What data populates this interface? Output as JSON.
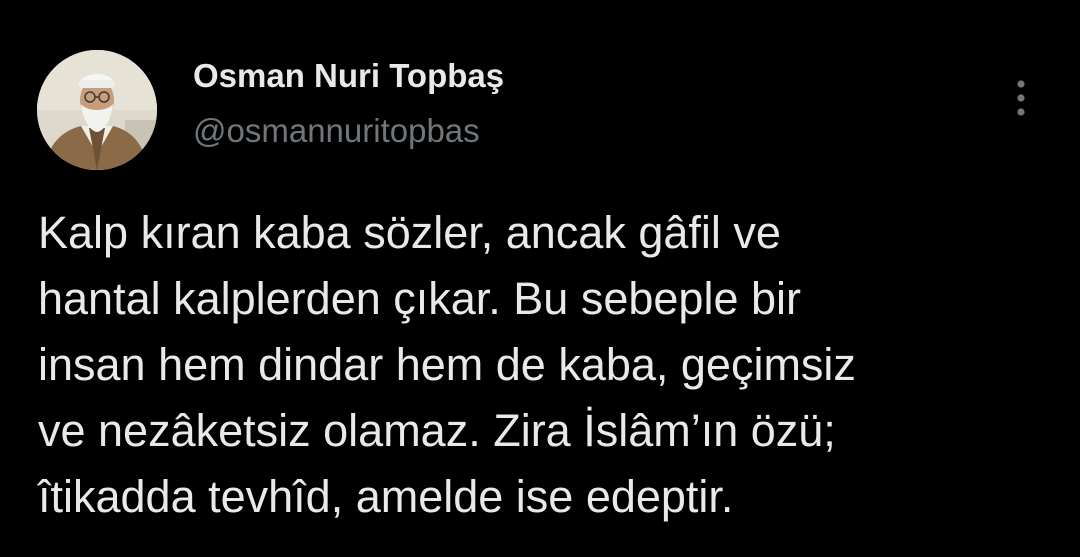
{
  "author": {
    "name": "Osman Nuri Topbaş",
    "handle": "@osmannuritopbas"
  },
  "menu": {
    "icon": "more-vertical-icon"
  },
  "tweet": {
    "lines": [
      "Kalp kıran kaba sözler, ancak gâfil ve",
      "hantal kalplerden çıkar. Bu sebeple bir",
      "insan hem dindar hem de kaba, geçimsiz",
      "ve nezâketsiz olamaz. Zira İslâm’ın özü;",
      "îtikadda tevhîd, amelde ise edeptir."
    ]
  },
  "colors": {
    "background": "#000000",
    "primary_text": "#e7e9ea",
    "secondary_text": "#71767b"
  }
}
